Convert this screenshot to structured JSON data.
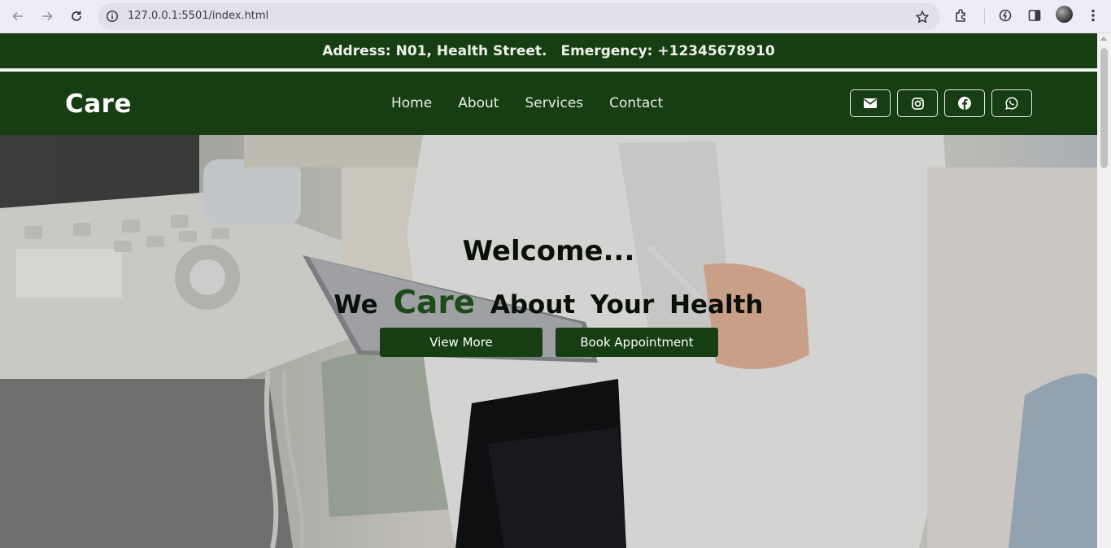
{
  "browser": {
    "url": "127.0.0.1:5501/index.html",
    "icons": [
      "back-arrow-icon",
      "forward-arrow-icon",
      "reload-icon",
      "info-icon",
      "star-icon",
      "extensions-icon",
      "performance-icon",
      "side-panel-icon",
      "profile-avatar",
      "more-menu-icon"
    ]
  },
  "topbar": {
    "address": "Address: N01, Health Street.",
    "emergency": "Emergency: +12345678910"
  },
  "header": {
    "brand": "Care",
    "menu": [
      {
        "label": "Home"
      },
      {
        "label": "About"
      },
      {
        "label": "Services"
      },
      {
        "label": "Contact"
      }
    ],
    "socials": [
      "mail-icon",
      "instagram-icon",
      "facebook-icon",
      "whatsapp-icon"
    ]
  },
  "hero": {
    "title": "Welcome...",
    "sub_before": "We",
    "sub_highlight": "Care",
    "sub_after": "About Your Health",
    "buttons": {
      "view_more": "View More",
      "book": "Book Appointment"
    }
  },
  "colors": {
    "brand_green": "#173d13",
    "highlight_green": "#1d4a1a"
  }
}
